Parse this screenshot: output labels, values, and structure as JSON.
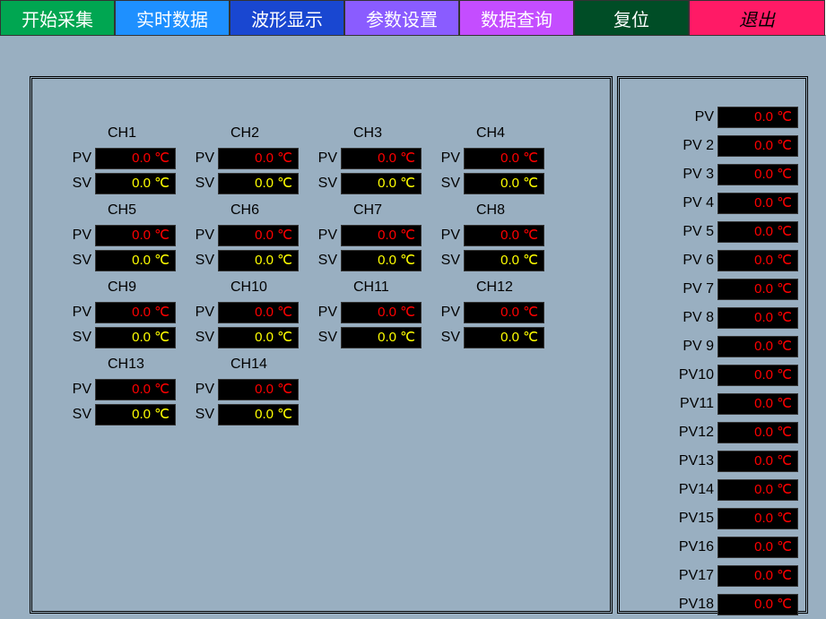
{
  "toolbar": {
    "start": "开始采集",
    "realtime": "实时数据",
    "wave": "波形显示",
    "param": "参数设置",
    "query": "数据查询",
    "reset": "复位",
    "exit": "退出"
  },
  "unit": "℃",
  "channels": [
    {
      "name": "CH1",
      "pv": "0.0 ℃",
      "sv": "0.0 ℃"
    },
    {
      "name": "CH2",
      "pv": "0.0 ℃",
      "sv": "0.0 ℃"
    },
    {
      "name": "CH3",
      "pv": "0.0 ℃",
      "sv": "0.0 ℃"
    },
    {
      "name": "CH4",
      "pv": "0.0 ℃",
      "sv": "0.0 ℃"
    },
    {
      "name": "CH5",
      "pv": "0.0 ℃",
      "sv": "0.0 ℃"
    },
    {
      "name": "CH6",
      "pv": "0.0 ℃",
      "sv": "0.0 ℃"
    },
    {
      "name": "CH7",
      "pv": "0.0 ℃",
      "sv": "0.0 ℃"
    },
    {
      "name": "CH8",
      "pv": "0.0 ℃",
      "sv": "0.0 ℃"
    },
    {
      "name": "CH9",
      "pv": "0.0 ℃",
      "sv": "0.0 ℃"
    },
    {
      "name": "CH10",
      "pv": "0.0 ℃",
      "sv": "0.0 ℃"
    },
    {
      "name": "CH11",
      "pv": "0.0 ℃",
      "sv": "0.0 ℃"
    },
    {
      "name": "CH12",
      "pv": "0.0 ℃",
      "sv": "0.0 ℃"
    },
    {
      "name": "CH13",
      "pv": "0.0 ℃",
      "sv": "0.0 ℃"
    },
    {
      "name": "CH14",
      "pv": "0.0 ℃",
      "sv": "0.0 ℃"
    }
  ],
  "labels": {
    "pv": "PV",
    "sv": "SV"
  },
  "pvlist": [
    {
      "label": "PV",
      "value": "0.0 ℃"
    },
    {
      "label": "PV 2",
      "value": "0.0 ℃"
    },
    {
      "label": "PV 3",
      "value": "0.0 ℃"
    },
    {
      "label": "PV 4",
      "value": "0.0 ℃"
    },
    {
      "label": "PV 5",
      "value": "0.0 ℃"
    },
    {
      "label": "PV 6",
      "value": "0.0 ℃"
    },
    {
      "label": "PV 7",
      "value": "0.0 ℃"
    },
    {
      "label": "PV 8",
      "value": "0.0 ℃"
    },
    {
      "label": "PV 9",
      "value": "0.0 ℃"
    },
    {
      "label": "PV10",
      "value": "0.0 ℃"
    },
    {
      "label": "PV11",
      "value": "0.0 ℃"
    },
    {
      "label": "PV12",
      "value": "0.0 ℃"
    },
    {
      "label": "PV13",
      "value": "0.0 ℃"
    },
    {
      "label": "PV14",
      "value": "0.0 ℃"
    },
    {
      "label": "PV15",
      "value": "0.0 ℃"
    },
    {
      "label": "PV16",
      "value": "0.0 ℃"
    },
    {
      "label": "PV17",
      "value": "0.0 ℃"
    },
    {
      "label": "PV18",
      "value": "0.0 ℃"
    }
  ]
}
